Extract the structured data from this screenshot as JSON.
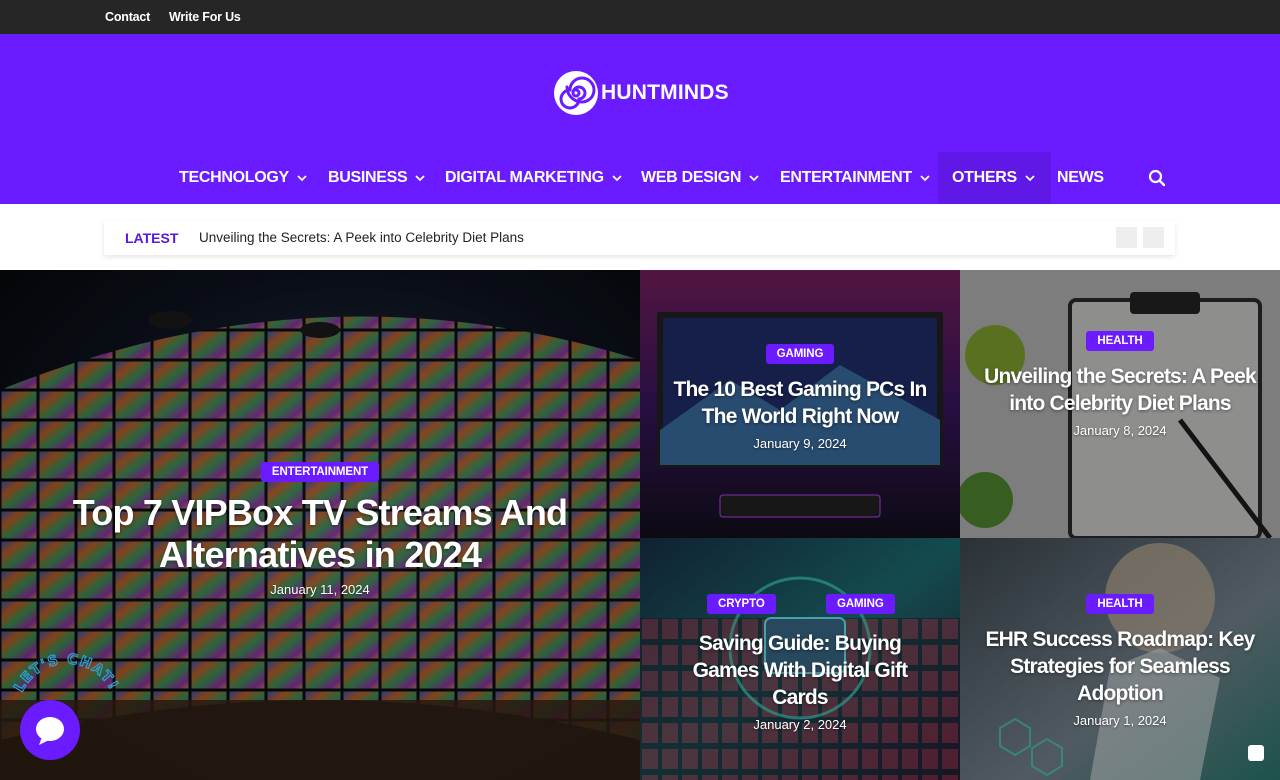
{
  "topbar": {
    "links": [
      "Contact",
      "Write For Us"
    ]
  },
  "header": {
    "logo_text": "HUNTMINDS",
    "nav": [
      {
        "label": "TECHNOLOGY",
        "dropdown": true
      },
      {
        "label": "BUSINESS",
        "dropdown": true
      },
      {
        "label": "DIGITAL MARKETING",
        "dropdown": true
      },
      {
        "label": "WEB DESIGN",
        "dropdown": true
      },
      {
        "label": "ENTERTAINMENT",
        "dropdown": true
      },
      {
        "label": "OTHERS",
        "dropdown": true
      },
      {
        "label": "NEWS",
        "dropdown": false
      }
    ],
    "search_icon": "search-icon"
  },
  "ticker": {
    "label": "LATEST",
    "headline": "Unveiling the Secrets: A Peek into Celebrity Diet Plans"
  },
  "posts": [
    {
      "categories": [
        "ENTERTAINMENT"
      ],
      "title": "Top 7 VIPBox TV Streams And Alternatives in 2024",
      "date": "January 11, 2024"
    },
    {
      "categories": [
        "GAMING"
      ],
      "title": "The 10 Best Gaming PCs In The World Right Now",
      "date": "January 9, 2024"
    },
    {
      "categories": [
        "HEALTH"
      ],
      "title": "Unveiling the Secrets: A Peek into Celebrity Diet Plans",
      "date": "January 8, 2024"
    },
    {
      "categories": [
        "CRYPTO",
        "GAMING"
      ],
      "title": "Saving Guide: Buying Games With Digital Gift Cards",
      "date": "January 2, 2024"
    },
    {
      "categories": [
        "HEALTH"
      ],
      "title": "EHR Success Roadmap: Key Strategies for Seamless Adoption",
      "date": "January 1, 2024"
    }
  ],
  "chat": {
    "label": "LET'S CHAT!"
  },
  "colors": {
    "brand": "#6a1bff",
    "topbar": "#262626"
  }
}
